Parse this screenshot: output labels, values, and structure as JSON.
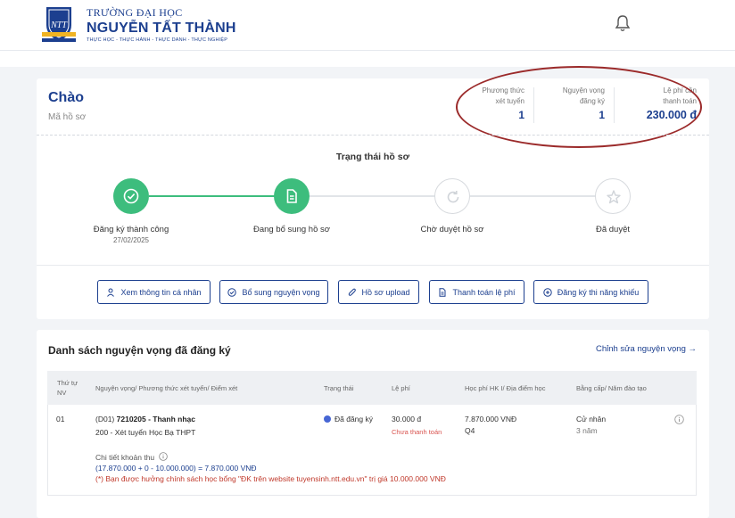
{
  "header": {
    "logo_line1": "TRƯỜNG ĐẠI HỌC",
    "logo_line2": "NGUYỄN TẤT THÀNH",
    "logo_line3": "THỰC HỌC - THỰC HÀNH - THỰC DANH - THỰC NGHIỆP",
    "seal_text": "NTT"
  },
  "profile": {
    "greeting": "Chào",
    "code_label": "Mã hồ sơ"
  },
  "stats": [
    {
      "label_line1": "Phương thức",
      "label_line2": "xét tuyển",
      "value": "1"
    },
    {
      "label_line1": "Nguyện vọng",
      "label_line2": "đăng ký",
      "value": "1"
    },
    {
      "label_line1": "Lệ phí cần",
      "label_line2": "thanh toán",
      "value": "230.000 đ"
    }
  ],
  "status": {
    "title": "Trạng thái hồ sơ",
    "steps": [
      {
        "label": "Đăng ký thành công",
        "date": "27/02/2025",
        "state": "done"
      },
      {
        "label": "Đang bổ sung hồ sơ",
        "date": "",
        "state": "done"
      },
      {
        "label": "Chờ duyệt hồ sơ",
        "date": "",
        "state": "pending"
      },
      {
        "label": "Đã duyệt",
        "date": "",
        "state": "pending"
      }
    ],
    "colors": {
      "done": "#3dbd7d",
      "pending": "#d7dade",
      "accent": "#1c3f8f"
    }
  },
  "actions": [
    {
      "label": "Xem thông tin cá nhân",
      "icon": "user-icon"
    },
    {
      "label": "Bổ sung nguyện vọng",
      "icon": "check-circle-icon"
    },
    {
      "label": "Hồ sơ upload",
      "icon": "paperclip-icon"
    },
    {
      "label": "Thanh toán lệ phí",
      "icon": "document-icon"
    },
    {
      "label": "Đăng ký thi năng khiếu",
      "icon": "plus-circle-icon"
    }
  ],
  "wishlist": {
    "title": "Danh sách nguyện vọng đã đăng ký",
    "edit_link": "Chỉnh sửa nguyện vọng →",
    "columns": {
      "order_line1": "Thứ tự",
      "order_line2": "NV",
      "program": "Nguyện vọng/ Phương thức xét tuyển/ Điểm xét",
      "status": "Trạng thái",
      "fee": "Lệ phí",
      "tuition": "Học phí HK I/ Địa điểm học",
      "degree": "Bằng cấp/ Năm đào tạo"
    },
    "rows": [
      {
        "order": "01",
        "program_prefix": "(D01)",
        "program_code_name": "7210205 - Thanh nhạc",
        "method": "200 - Xét tuyển Học Bạ THPT",
        "status": "Đã đăng ký",
        "fee": "30.000 đ",
        "fee_status": "Chưa thanh toán",
        "tuition": "7.870.000 VNĐ",
        "location": "Q4",
        "degree": "Cử nhân",
        "years": "3 năm",
        "detail_label": "Chi tiết khoản thu",
        "detail_formula": "(17.870.000 + 0 - 10.000.000) = 7.870.000 VNĐ",
        "detail_note": "(*) Bạn được hưởng chính sách học bổng \"ĐK trên website tuyensinh.ntt.edu.vn\" trị giá 10.000.000 VNĐ"
      }
    ]
  }
}
